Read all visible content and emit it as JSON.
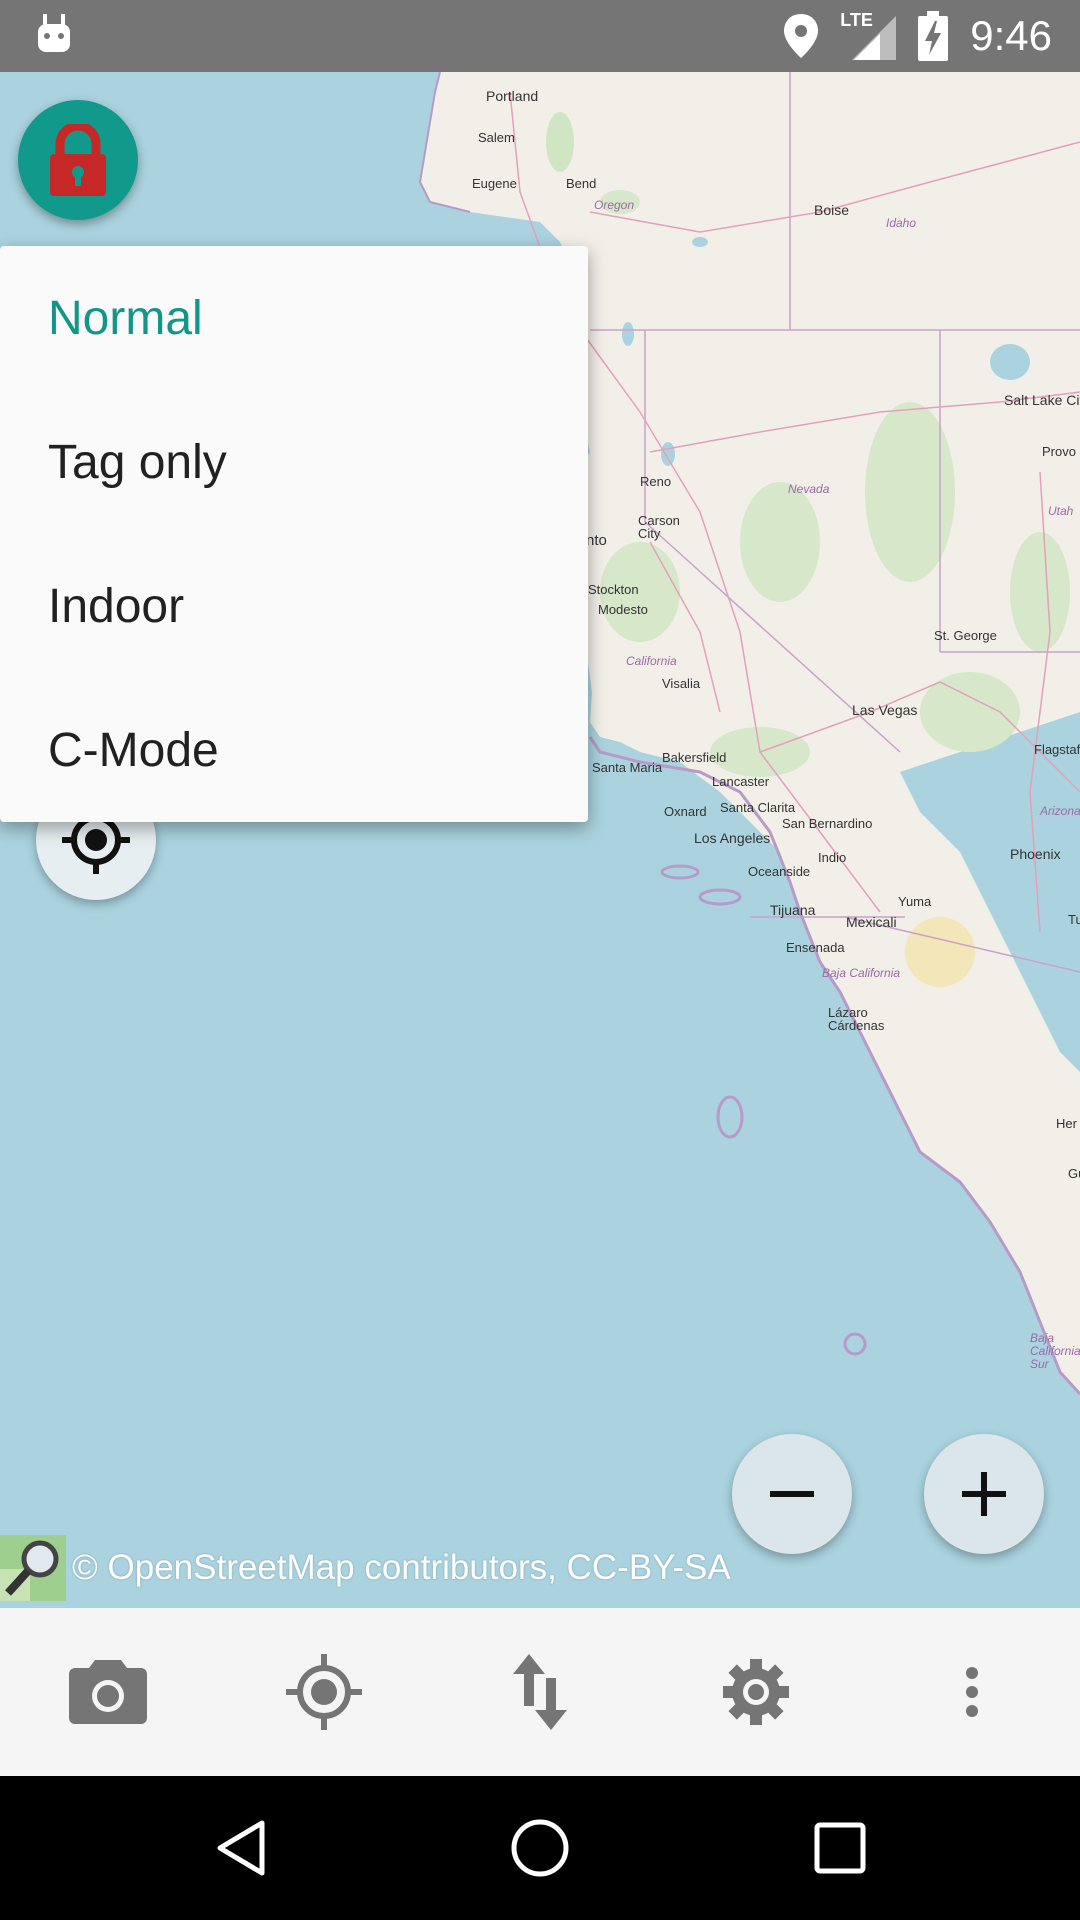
{
  "status_bar": {
    "time": "9:46",
    "network": "LTE",
    "icons": [
      "android-icon",
      "location-icon",
      "lte-signal-icon",
      "battery-charging-icon"
    ]
  },
  "map": {
    "labels": [
      {
        "id": "portland",
        "text": "Portland"
      },
      {
        "id": "salem",
        "text": "Salem"
      },
      {
        "id": "eugene",
        "text": "Eugene"
      },
      {
        "id": "bend",
        "text": "Bend"
      },
      {
        "id": "oregon",
        "text": "Oregon"
      },
      {
        "id": "boise",
        "text": "Boise"
      },
      {
        "id": "idaho",
        "text": "Idaho"
      },
      {
        "id": "salt_lake",
        "text": "Salt Lake City"
      },
      {
        "id": "provo",
        "text": "Provo"
      },
      {
        "id": "utah",
        "text": "Utah"
      },
      {
        "id": "reno",
        "text": "Reno"
      },
      {
        "id": "nevada",
        "text": "Nevada"
      },
      {
        "id": "carson",
        "text": "Carson City"
      },
      {
        "id": "nto",
        "text": "nto"
      },
      {
        "id": "stockton",
        "text": "Stockton"
      },
      {
        "id": "modesto",
        "text": "Modesto"
      },
      {
        "id": "california",
        "text": "California"
      },
      {
        "id": "st_george",
        "text": "St. George"
      },
      {
        "id": "visalia",
        "text": "Visalia"
      },
      {
        "id": "las_vegas",
        "text": "Las Vegas"
      },
      {
        "id": "bakersfield",
        "text": "Bakersfield"
      },
      {
        "id": "flagstaff",
        "text": "Flagstaff"
      },
      {
        "id": "santa_maria",
        "text": "Santa Maria"
      },
      {
        "id": "lancaster",
        "text": "Lancaster"
      },
      {
        "id": "oxnard",
        "text": "Oxnard"
      },
      {
        "id": "santa_clarita",
        "text": "Santa Clarita"
      },
      {
        "id": "arizona",
        "text": "Arizona"
      },
      {
        "id": "san_bernardino",
        "text": "San Bernardino"
      },
      {
        "id": "los_angeles",
        "text": "Los Angeles"
      },
      {
        "id": "phoenix",
        "text": "Phoenix"
      },
      {
        "id": "indio",
        "text": "Indio"
      },
      {
        "id": "oceanside",
        "text": "Oceanside"
      },
      {
        "id": "yuma",
        "text": "Yuma"
      },
      {
        "id": "tijuana",
        "text": "Tijuana"
      },
      {
        "id": "mexicali",
        "text": "Mexicali"
      },
      {
        "id": "tu",
        "text": "Tu"
      },
      {
        "id": "ensenada",
        "text": "Ensenada"
      },
      {
        "id": "baja_california",
        "text": "Baja California"
      },
      {
        "id": "lazaro",
        "text": "Lázaro Cárdenas"
      },
      {
        "id": "her",
        "text": "Her"
      },
      {
        "id": "gu",
        "text": "Gu"
      },
      {
        "id": "baja_sur",
        "text": "Baja California Sur"
      }
    ]
  },
  "mode_menu": {
    "items": [
      {
        "label": "Normal",
        "selected": true
      },
      {
        "label": "Tag only",
        "selected": false
      },
      {
        "label": "Indoor",
        "selected": false
      },
      {
        "label": "C-Mode",
        "selected": false
      }
    ]
  },
  "attribution": {
    "text": "© OpenStreetMap contributors, CC-BY-SA"
  },
  "toolbar": {
    "items": [
      "camera-icon",
      "gps-icon",
      "transfer-icon",
      "settings-icon",
      "overflow-menu-icon"
    ]
  },
  "colors": {
    "status_bar": "#757575",
    "water": "#aad3df",
    "land": "#f2efe9",
    "accent": "#129688",
    "lock_red": "#c62828",
    "toolbar": "#f5f5f5",
    "nav_bar": "#000000"
  }
}
